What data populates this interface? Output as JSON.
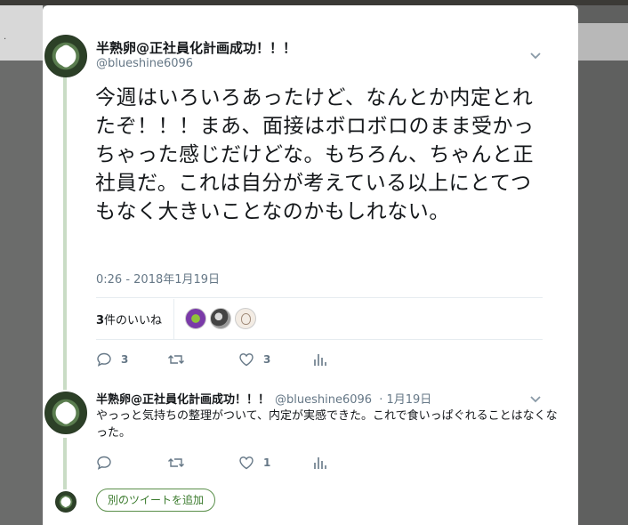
{
  "main_tweet": {
    "display_name": "半熟卵@正社員化計画成功！！！",
    "handle": "@blueshine6096",
    "text": "今週はいろいろあったけど、なんとか内定とれたぞ！！！まあ、面接はボロボロのまま受かっちゃった感じだけどな。もちろん、ちゃんと正社員だ。これは自分が考えている以上にとてつもなく大きいことなのかもしれない。",
    "timestamp": "0:26 - 2018年1月19日",
    "likes_count": "3",
    "likes_suffix": "件のいいね",
    "reply_count": "3",
    "retweet_count": "",
    "like_count": "3"
  },
  "reply_tweet": {
    "display_name": "半熟卵@正社員化計画成功！！！",
    "handle": "@blueshine6096",
    "date": "· 1月19日",
    "text": "やっっと気持ちの整理がついて、内定が実感できた。これで食いっぱぐれることはなくなった。",
    "reply_count": "",
    "retweet_count": "",
    "like_count": "1"
  },
  "add_tweet_label": "別のツイートを追加",
  "icons": {
    "reply": "reply-icon",
    "retweet": "retweet-icon",
    "like": "heart-icon",
    "analytics": "analytics-icon",
    "caret": "chevron-down-icon"
  },
  "colors": {
    "accent_green": "#3a7a2c",
    "thread_line": "#c9dcc5",
    "secondary_text": "#657786"
  }
}
